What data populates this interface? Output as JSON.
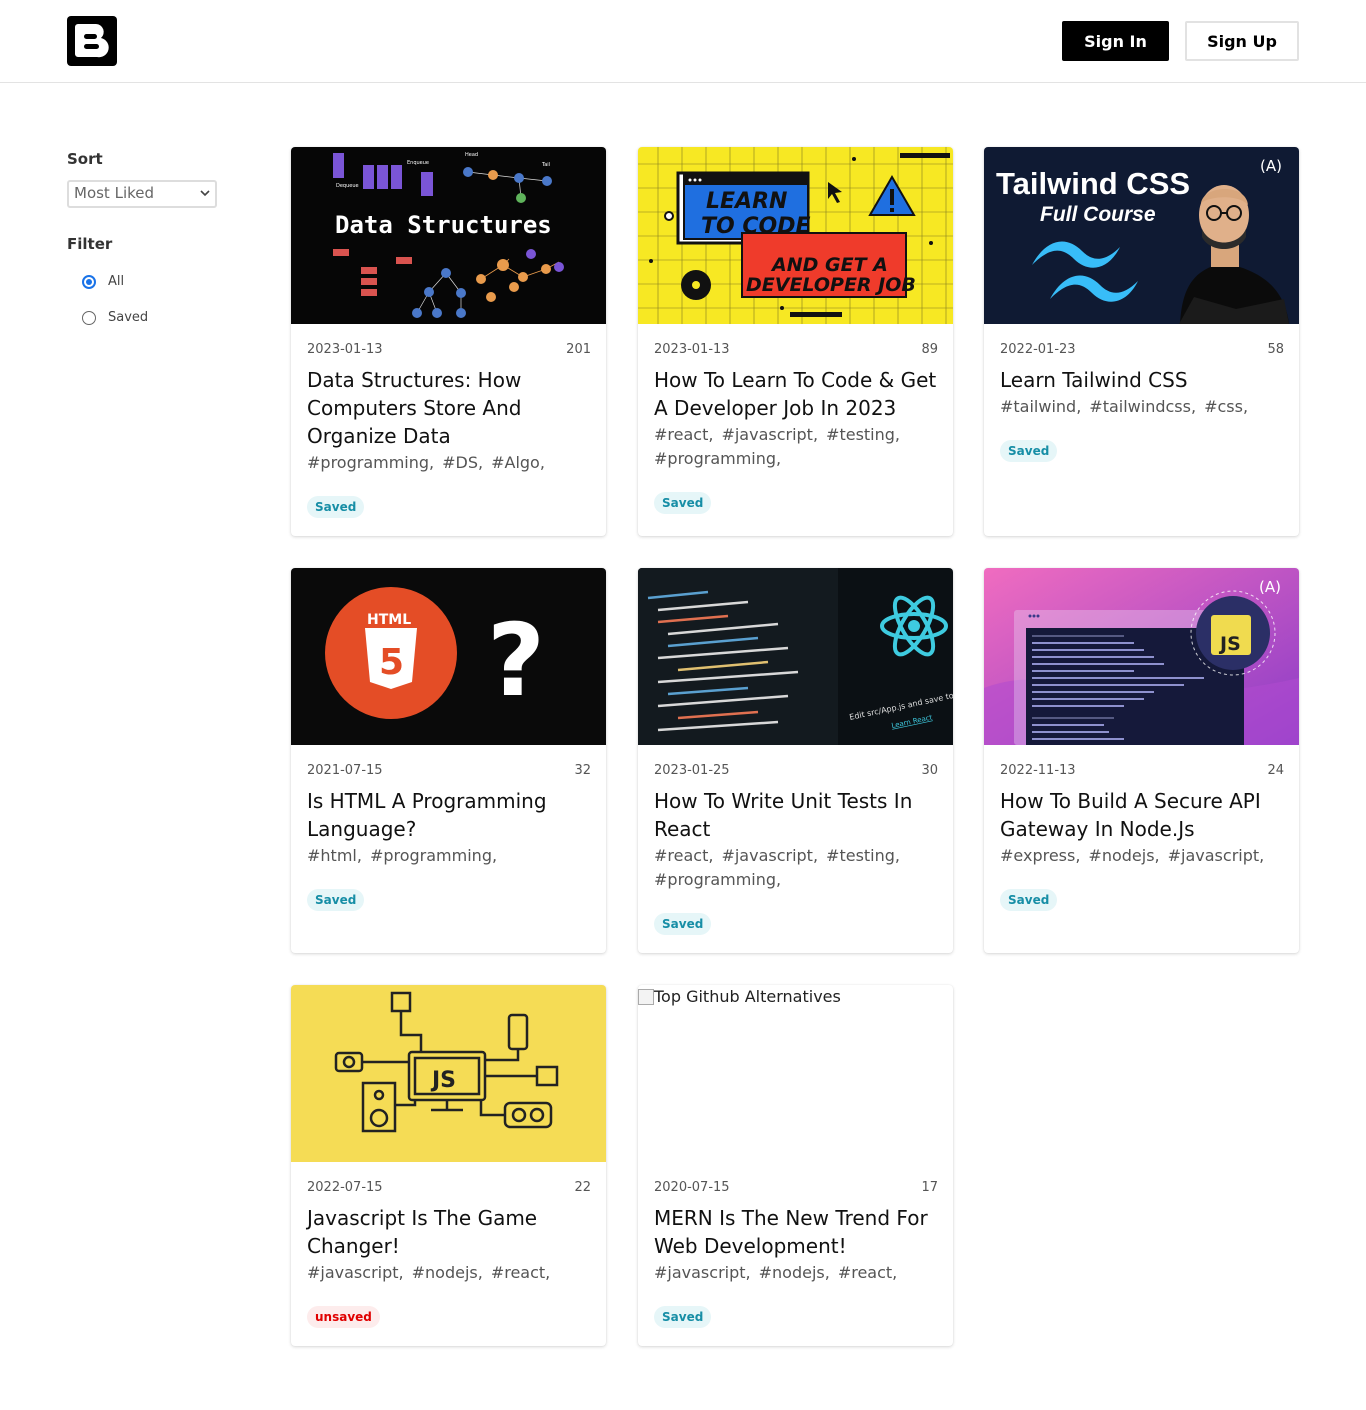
{
  "header": {
    "logo_alt": "Blogger",
    "signin_label": "Sign In",
    "signup_label": "Sign Up"
  },
  "sidebar": {
    "sort_heading": "Sort",
    "sort_selected": "Most Liked",
    "filter_heading": "Filter",
    "filter_options": [
      {
        "label": "All",
        "checked": true
      },
      {
        "label": "Saved",
        "checked": false
      }
    ]
  },
  "posts": [
    {
      "date": "2023-01-13",
      "likes": "201",
      "title": "Data Structures: How Computers Store And Organize Data",
      "tags": [
        "#programming,",
        "#DS,",
        "#Algo,"
      ],
      "status": "Saved",
      "thumb_text": "Data Structures",
      "thumb_labels": [
        "Enqueue",
        "Dequeue",
        "Head",
        "Tail",
        "Peak",
        "Data",
        "Data",
        "Push",
        "Pop",
        "Data",
        "Data",
        "Data"
      ]
    },
    {
      "date": "2023-01-13",
      "likes": "89",
      "title": "How To Learn To Code & Get A Developer Job In 2023",
      "tags": [
        "#react,",
        "#javascript,",
        "#testing,",
        "#programming,"
      ],
      "status": "Saved",
      "thumb_text": [
        "LEARN",
        "TO CODE",
        "AND GET A",
        "DEVELOPER JOB"
      ]
    },
    {
      "date": "2022-01-23",
      "likes": "58",
      "title": "Learn Tailwind CSS",
      "tags": [
        "#tailwind,",
        "#tailwindcss,",
        "#css,"
      ],
      "status": "Saved",
      "thumb_text": [
        "Tailwind CSS",
        "Full Course",
        "(A)"
      ]
    },
    {
      "date": "2021-07-15",
      "likes": "32",
      "title": "Is HTML A Programming Language?",
      "tags": [
        "#html,",
        "#programming,"
      ],
      "status": "Saved",
      "thumb_text": [
        "HTML",
        "5",
        "?"
      ]
    },
    {
      "date": "2023-01-25",
      "likes": "30",
      "title": "How To Write Unit Tests In React",
      "tags": [
        "#react,",
        "#javascript,",
        "#testing,",
        "#programming,"
      ],
      "status": "Saved",
      "thumb_text": [
        "Edit src/App.js and save to reload.",
        "Learn React"
      ]
    },
    {
      "date": "2022-11-13",
      "likes": "24",
      "title": "How To Build A Secure API Gateway In Node.Js",
      "tags": [
        "#express,",
        "#nodejs,",
        "#javascript,"
      ],
      "status": "Saved",
      "thumb_text": [
        "JS",
        "(A)"
      ]
    },
    {
      "date": "2022-07-15",
      "likes": "22",
      "title": "Javascript Is The Game Changer!",
      "tags": [
        "#javascript,",
        "#nodejs,",
        "#react,"
      ],
      "status": "unsaved",
      "thumb_text": [
        "JS"
      ]
    },
    {
      "date": "2020-07-15",
      "likes": "17",
      "title": "MERN Is The New Trend For Web Development!",
      "tags": [
        "#javascript,",
        "#nodejs,",
        "#react,"
      ],
      "status": "Saved",
      "thumb_alt": "Top Github Alternatives"
    }
  ],
  "colors": {
    "saved_bg": "#e6f6f8",
    "saved_fg": "#178ea6",
    "unsaved_bg": "#fdecec",
    "unsaved_fg": "#e00000",
    "primary_button": "#000000"
  }
}
